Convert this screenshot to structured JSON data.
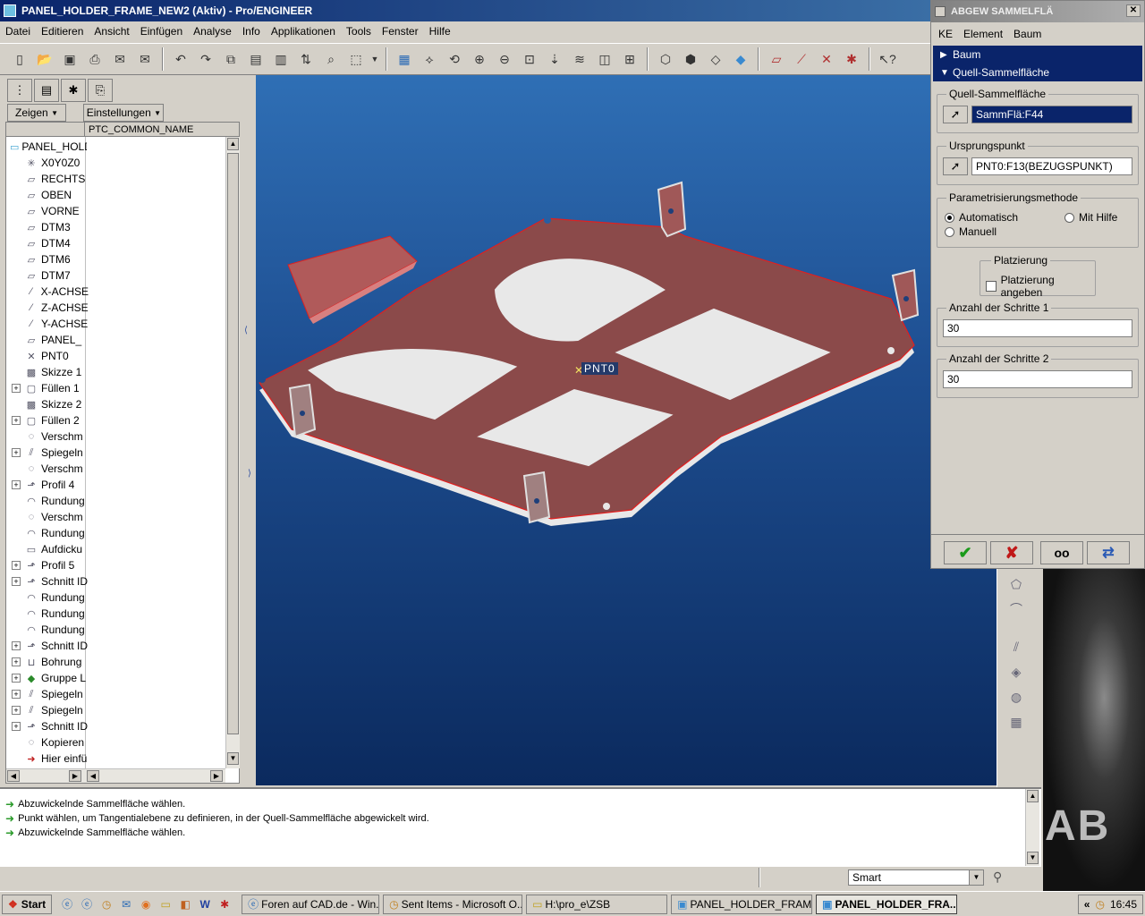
{
  "window": {
    "title": "PANEL_HOLDER_FRAME_NEW2 (Aktiv) - Pro/ENGINEER",
    "menu": [
      "Datei",
      "Editieren",
      "Ansicht",
      "Einfügen",
      "Analyse",
      "Info",
      "Applikationen",
      "Tools",
      "Fenster",
      "Hilfe"
    ]
  },
  "toolbar": {
    "icons": [
      "new-icon",
      "open-icon",
      "save-icon",
      "print-icon",
      "email-icon",
      "email-attach-icon",
      "undo-icon",
      "redo-icon",
      "copy-icon",
      "paste-icon",
      "paste-special-icon",
      "regenerate-icon",
      "find-icon",
      "select-box-icon",
      "repaint-icon",
      "spin-center-icon",
      "orient-icon",
      "zoom-in-icon",
      "zoom-out-icon",
      "zoom-fit-icon",
      "saved-views-icon",
      "layers-icon",
      "view-manager-icon",
      "wireframe-icon",
      "hidden-line-icon",
      "no-hidden-icon",
      "shaded-icon",
      "datum-planes-icon",
      "datum-axes-icon",
      "datum-points-icon",
      "csys-icon",
      "context-help-icon"
    ]
  },
  "left_panel": {
    "show_btn": "Zeigen",
    "settings_btn": "Einstellungen",
    "column_header": "PTC_COMMON_NAME",
    "tree": [
      {
        "label": "PANEL_HOLD",
        "icon": "part-icon",
        "exp": false
      },
      {
        "label": "X0Y0Z0",
        "icon": "csys-icon",
        "exp": false
      },
      {
        "label": "RECHTS",
        "icon": "datum-plane-icon",
        "exp": false
      },
      {
        "label": "OBEN",
        "icon": "datum-plane-icon",
        "exp": false
      },
      {
        "label": "VORNE",
        "icon": "datum-plane-icon",
        "exp": false
      },
      {
        "label": "DTM3",
        "icon": "datum-plane-icon",
        "exp": false
      },
      {
        "label": "DTM4",
        "icon": "datum-plane-icon",
        "exp": false
      },
      {
        "label": "DTM6",
        "icon": "datum-plane-icon",
        "exp": false
      },
      {
        "label": "DTM7",
        "icon": "datum-plane-icon",
        "exp": false
      },
      {
        "label": "X-ACHSE",
        "icon": "axis-icon",
        "exp": false
      },
      {
        "label": "Z-ACHSE",
        "icon": "axis-icon",
        "exp": false
      },
      {
        "label": "Y-ACHSE",
        "icon": "axis-icon",
        "exp": false
      },
      {
        "label": "PANEL_",
        "icon": "datum-plane-icon",
        "exp": false
      },
      {
        "label": "PNT0",
        "icon": "datum-point-icon",
        "exp": false
      },
      {
        "label": "Skizze 1",
        "icon": "sketch-icon",
        "exp": false
      },
      {
        "label": "Füllen 1",
        "icon": "fill-icon",
        "exp": true
      },
      {
        "label": "Skizze 2",
        "icon": "sketch-icon",
        "exp": false
      },
      {
        "label": "Füllen 2",
        "icon": "fill-icon",
        "exp": true
      },
      {
        "label": "Verschm",
        "icon": "merge-icon",
        "exp": false
      },
      {
        "label": "Spiegeln",
        "icon": "mirror-icon",
        "exp": true
      },
      {
        "label": "Verschm",
        "icon": "merge-icon",
        "exp": false
      },
      {
        "label": "Profil 4",
        "icon": "profile-icon",
        "exp": true
      },
      {
        "label": "Rundung",
        "icon": "round-icon",
        "exp": false
      },
      {
        "label": "Verschm",
        "icon": "merge-icon",
        "exp": false
      },
      {
        "label": "Rundung",
        "icon": "round-icon",
        "exp": false
      },
      {
        "label": "Aufdicku",
        "icon": "thicken-icon",
        "exp": false
      },
      {
        "label": "Profil 5",
        "icon": "profile-icon",
        "exp": true
      },
      {
        "label": "Schnitt ID",
        "icon": "cut-icon",
        "exp": true
      },
      {
        "label": "Rundung",
        "icon": "round-icon",
        "exp": false
      },
      {
        "label": "Rundung",
        "icon": "round-icon",
        "exp": false
      },
      {
        "label": "Rundung",
        "icon": "round-icon",
        "exp": false
      },
      {
        "label": "Schnitt ID",
        "icon": "cut-icon",
        "exp": true
      },
      {
        "label": "Bohrung",
        "icon": "hole-icon",
        "exp": true
      },
      {
        "label": "Gruppe L",
        "icon": "group-icon",
        "exp": true
      },
      {
        "label": "Spiegeln",
        "icon": "mirror-icon",
        "exp": true
      },
      {
        "label": "Spiegeln",
        "icon": "mirror-icon",
        "exp": true
      },
      {
        "label": "Schnitt ID",
        "icon": "cut-icon",
        "exp": true
      },
      {
        "label": "Kopieren",
        "icon": "copy-feature-icon",
        "exp": false
      },
      {
        "label": "Hier einfü",
        "icon": "insert-here-icon",
        "exp": false
      }
    ]
  },
  "viewport": {
    "point_label": "PNT0",
    "part_color": "#8b4a4a",
    "edge_color": "#e02020"
  },
  "dialog": {
    "title": "ABGEW SAMMELFLÄ",
    "menu": [
      "KE",
      "Element",
      "Baum"
    ],
    "nav": [
      "Baum",
      "Quell-Sammelfläche"
    ],
    "source_group": "Quell-Sammelfläche",
    "source_value": "SammFlä:F44",
    "origin_group": "Ursprungspunkt",
    "origin_value": "PNT0:F13(BEZUGSPUNKT)",
    "param_group": "Parametrisierungsmethode",
    "radio_auto": "Automatisch",
    "radio_help": "Mit Hilfe",
    "radio_manual": "Manuell",
    "placement_group": "Platzierung",
    "placement_check": "Platzierung angeben",
    "steps1_group": "Anzahl der Schritte 1",
    "steps1_value": "30",
    "steps2_group": "Anzahl der Schritte 2",
    "steps2_value": "30"
  },
  "messages": [
    "Abzuwickelnde Sammelfläche wählen.",
    "Punkt wählen, um Tangentialebene zu definieren, in der Quell-Sammelfläche abgewickelt wird.",
    "Abzuwickelnde Sammelfläche wählen."
  ],
  "status": {
    "filter": "Smart"
  },
  "taskbar": {
    "start": "Start",
    "tasks": [
      "Foren auf CAD.de - Win...",
      "Sent Items - Microsoft O...",
      "H:\\pro_e\\ZSB",
      "PANEL_HOLDER_FRAME...",
      "PANEL_HOLDER_FRA..."
    ],
    "time": "16:45"
  },
  "background_image": {
    "text": "AB"
  }
}
